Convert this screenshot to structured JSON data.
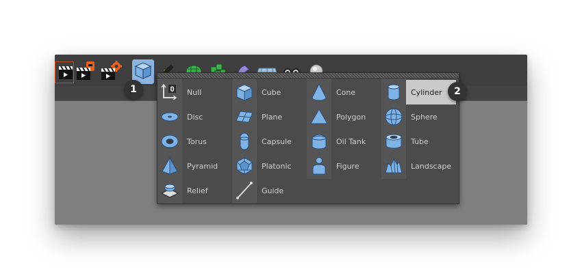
{
  "menu": {
    "items": [
      {
        "label": "Null",
        "icon": "null-icon"
      },
      {
        "label": "Disc",
        "icon": "disc-icon"
      },
      {
        "label": "Torus",
        "icon": "torus-icon"
      },
      {
        "label": "Pyramid",
        "icon": "pyramid-icon"
      },
      {
        "label": "Relief",
        "icon": "relief-icon"
      },
      {
        "label": "Cube",
        "icon": "cube-icon"
      },
      {
        "label": "Plane",
        "icon": "plane-icon"
      },
      {
        "label": "Capsule",
        "icon": "capsule-icon"
      },
      {
        "label": "Platonic",
        "icon": "platonic-icon"
      },
      {
        "label": "Guide",
        "icon": "guide-icon"
      },
      {
        "label": "Cone",
        "icon": "cone-icon"
      },
      {
        "label": "Polygon",
        "icon": "polygon-icon"
      },
      {
        "label": "Oil Tank",
        "icon": "oil-tank-icon"
      },
      {
        "label": "Figure",
        "icon": "figure-icon"
      },
      {
        "label": "Cylinder",
        "icon": "cylinder-icon"
      },
      {
        "label": "Sphere",
        "icon": "sphere-icon"
      },
      {
        "label": "Tube",
        "icon": "tube-icon"
      },
      {
        "label": "Landscape",
        "icon": "landscape-icon"
      }
    ],
    "selected": "Cylinder"
  },
  "callouts": {
    "first": "1",
    "second": "2"
  },
  "colors": {
    "accent": "#8db3e0",
    "icon_fill": "#7fb2e5",
    "icon_stroke": "#2a4f7a",
    "popup_bg": "#4b4b4b",
    "selected_bg": "#c9c9c9"
  }
}
